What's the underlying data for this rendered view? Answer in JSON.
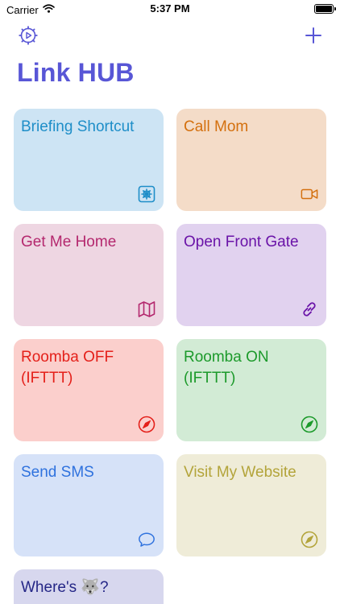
{
  "status": {
    "carrier": "Carrier",
    "time": "5:37 PM"
  },
  "header": {
    "title": "Link HUB"
  },
  "cards": [
    {
      "label": "Briefing Shortcut",
      "icon": "shortcuts-icon",
      "bg": "#cde4f4",
      "color": "#1e8ec8"
    },
    {
      "label": "Call Mom",
      "icon": "video-camera-icon",
      "bg": "#f4dcc8",
      "color": "#d4700e"
    },
    {
      "label": "Get Me Home",
      "icon": "map-icon",
      "bg": "#eed6e2",
      "color": "#b4286e"
    },
    {
      "label": "Open Front Gate",
      "icon": "link-icon",
      "bg": "#e1d2ef",
      "color": "#6a13a8"
    },
    {
      "label": "Roomba OFF (IFTTT)",
      "icon": "compass-icon",
      "bg": "#fbcfcc",
      "color": "#e4201a"
    },
    {
      "label": "Roomba ON (IFTTT)",
      "icon": "compass-icon",
      "bg": "#d2ebd5",
      "color": "#1c9a2b"
    },
    {
      "label": "Send SMS",
      "icon": "message-bubble-icon",
      "bg": "#d6e2f8",
      "color": "#2f72de"
    },
    {
      "label": "Visit My Website",
      "icon": "compass-icon",
      "bg": "#efecd8",
      "color": "#b3a43a"
    },
    {
      "label": "Where's 🐺?",
      "icon": "",
      "bg": "#d7d7ee",
      "color": "#242686"
    }
  ]
}
